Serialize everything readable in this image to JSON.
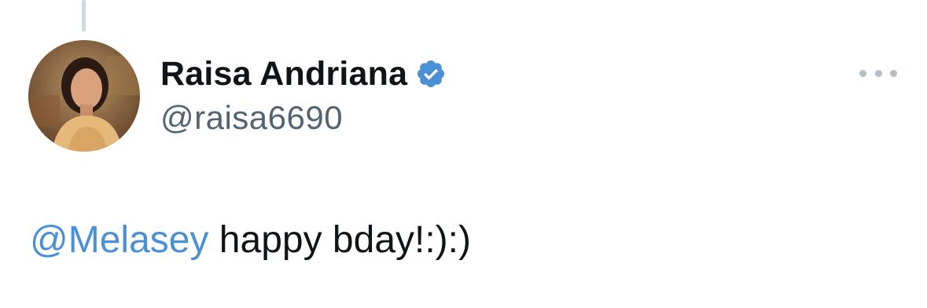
{
  "tweet": {
    "author": {
      "display_name": "Raisa Andriana",
      "handle": "@raisa6690",
      "verified": true,
      "avatar_icon": "profile-photo"
    },
    "text": {
      "mention": "@Melasey",
      "body": " happy bday!:):)"
    },
    "more_icon": "more-options-icon"
  },
  "colors": {
    "mention": "#4a90d6",
    "verified_badge": "#4a90d6",
    "handle": "#536471",
    "thread_line": "#cfd9de"
  }
}
